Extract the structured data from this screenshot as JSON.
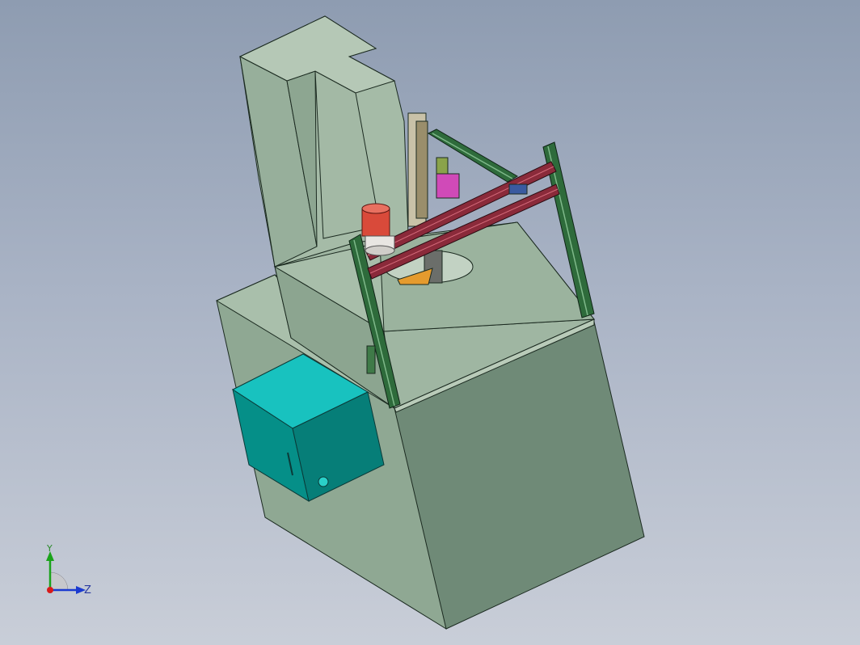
{
  "viewport": {
    "background_top": "#8e9cb1",
    "background_bottom": "#c9ced8"
  },
  "colors": {
    "body_light": "#a7bda9",
    "body_mid": "#8fa893",
    "body_dark": "#6f8a77",
    "cabinet_front": "#058f88",
    "cabinet_top": "#18c2bf",
    "rail_green": "#2e6b3b",
    "beam_red": "#8a2a3a",
    "lamp_red": "#d94a3a"
  },
  "triad": {
    "y_label": "Y",
    "z_label": "Z"
  }
}
